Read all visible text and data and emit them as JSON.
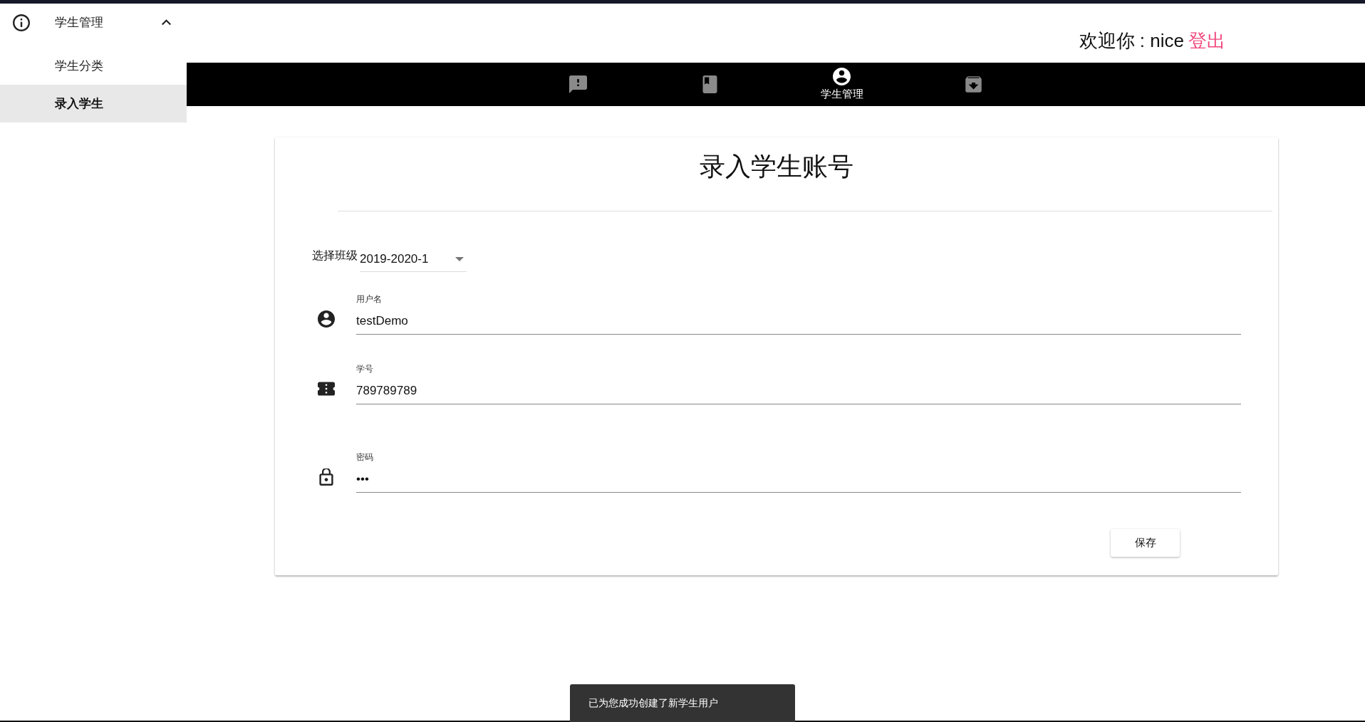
{
  "sidebar": {
    "group": {
      "label": "学生管理",
      "expanded": true,
      "items": [
        {
          "label": "学生分类",
          "selected": false
        },
        {
          "label": "录入学生",
          "selected": true
        }
      ]
    }
  },
  "header": {
    "greeting": "欢迎你 : nice",
    "logout": "登出"
  },
  "nav_tabs": [
    {
      "selected": false
    },
    {
      "selected": false
    },
    {
      "label": "学生管理",
      "selected": true
    },
    {
      "selected": false
    }
  ],
  "form": {
    "title": "录入学生账号",
    "class_select": {
      "label": "选择班级",
      "value": "2019-2020-1"
    },
    "fields": [
      {
        "label": "用户名",
        "value": "testDemo"
      },
      {
        "label": "学号",
        "value": "789789789"
      },
      {
        "label": "密码",
        "value": "•••"
      }
    ],
    "save_button": "保存"
  },
  "snackbar": {
    "message": "已为您成功创建了新学生用户"
  }
}
